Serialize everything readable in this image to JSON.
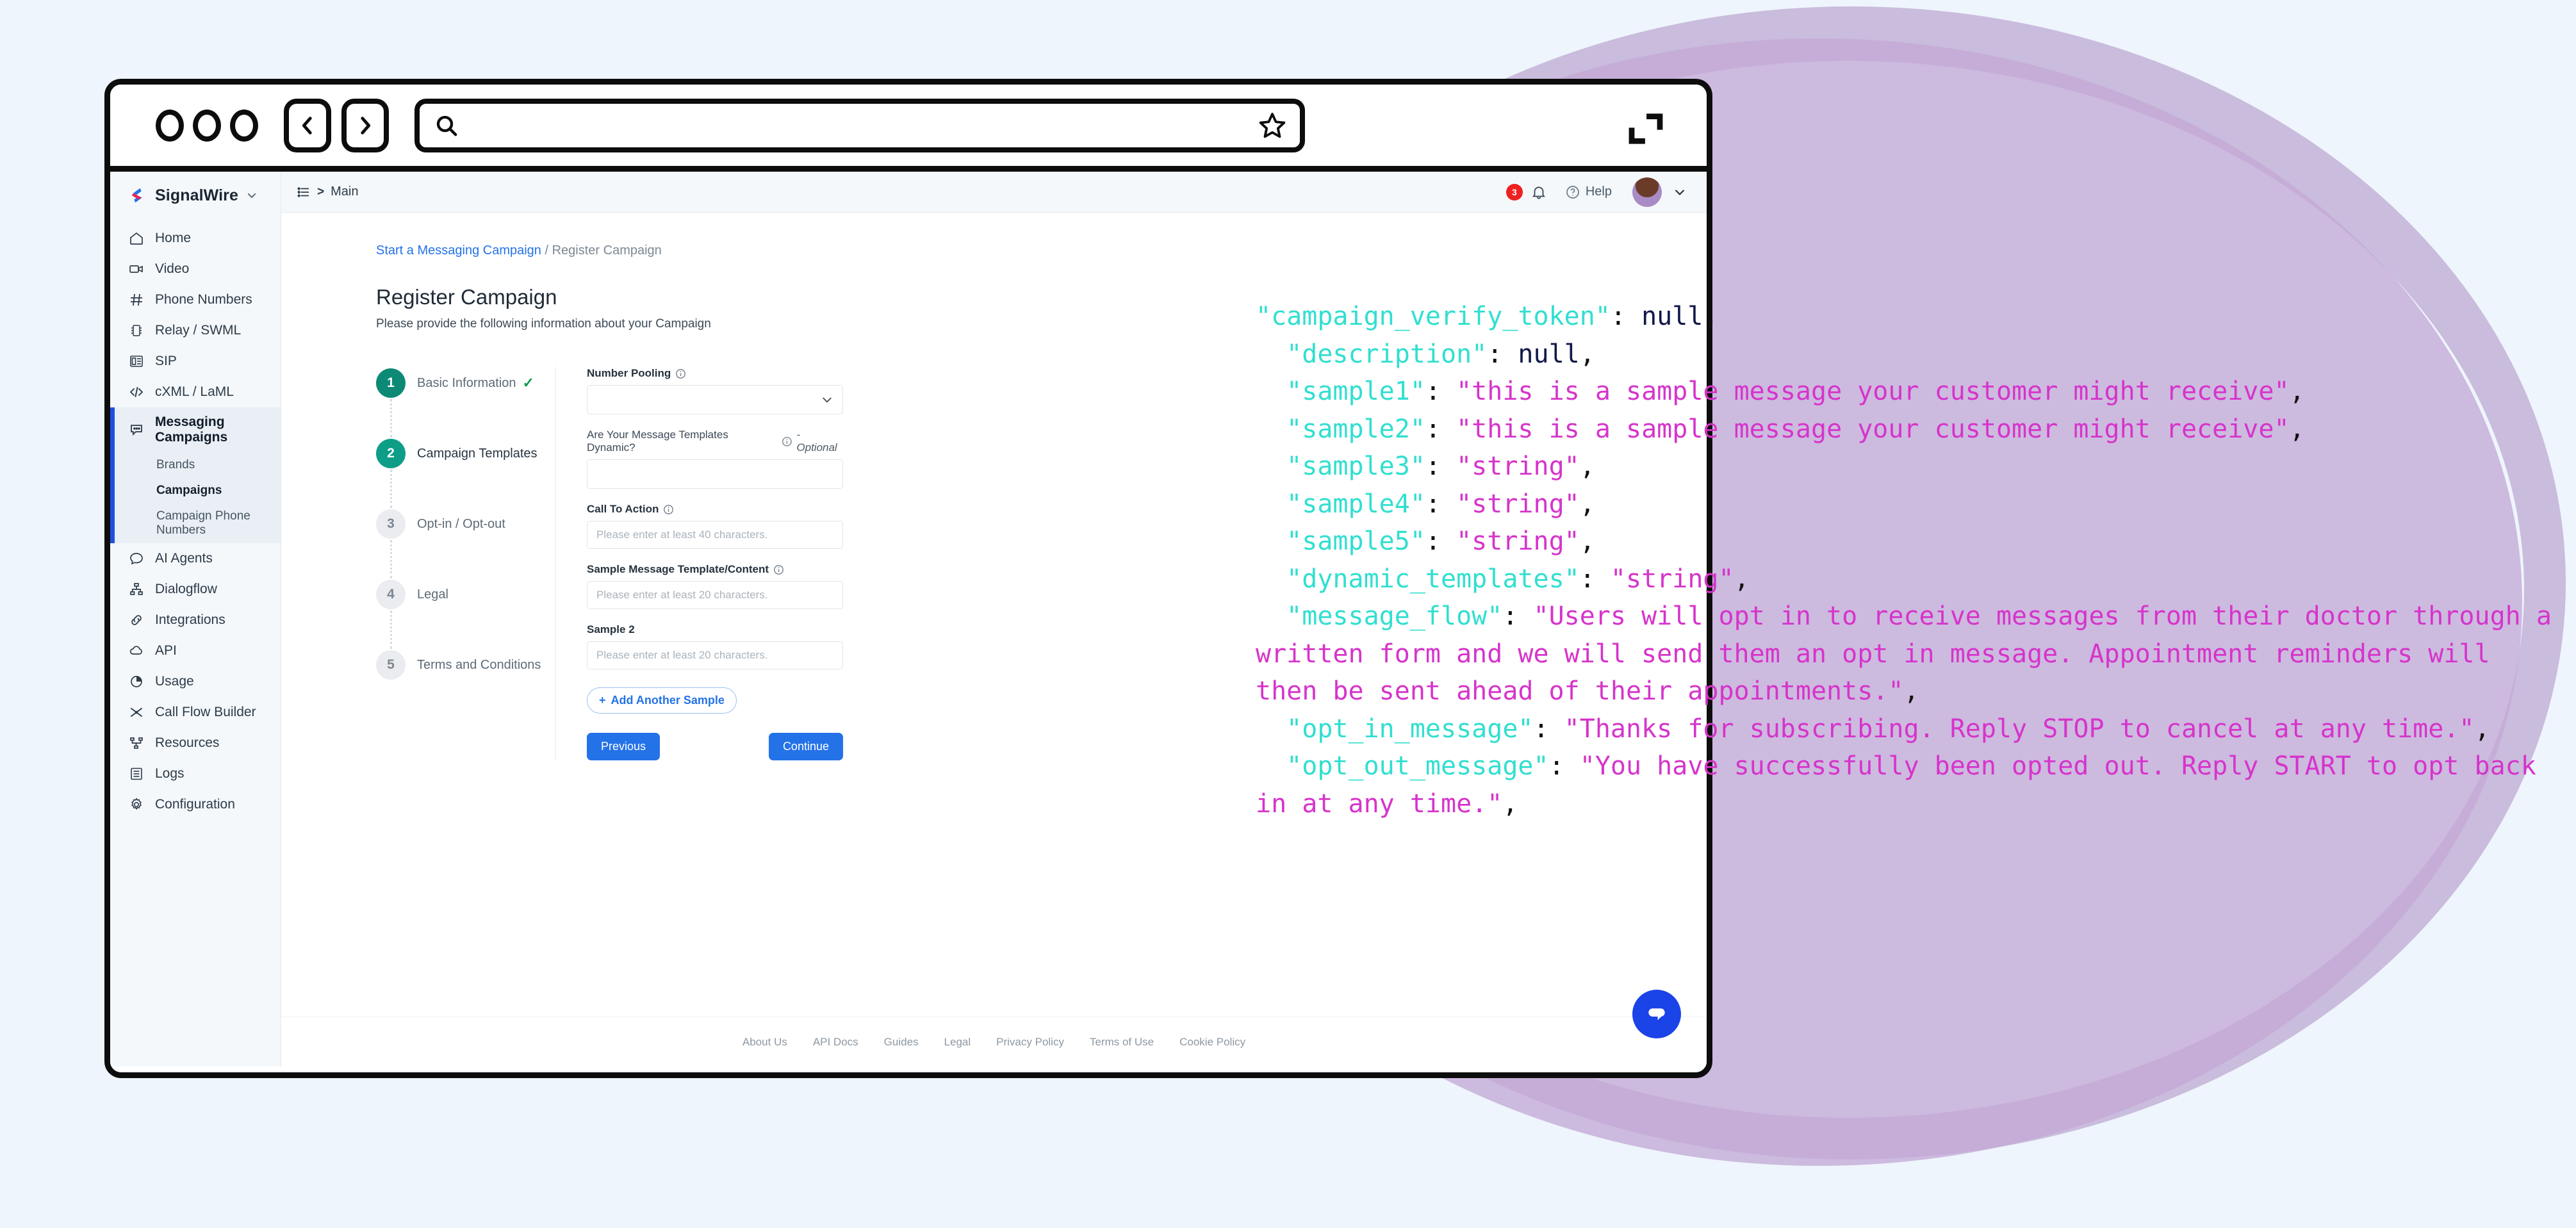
{
  "browser": {
    "dots_count": 3,
    "back_label": "back",
    "forward_label": "forward",
    "address_value": "",
    "address_placeholder": "",
    "bookmark_label": "Bookmark",
    "expand_label": "Expand"
  },
  "sidebar": {
    "brand": "SignalWire",
    "items": [
      {
        "label": "Home",
        "icon": "home-icon"
      },
      {
        "label": "Video",
        "icon": "video-icon"
      },
      {
        "label": "Phone Numbers",
        "icon": "hash-icon"
      },
      {
        "label": "Relay / SWML",
        "icon": "chip-icon"
      },
      {
        "label": "SIP",
        "icon": "deskphone-icon"
      },
      {
        "label": "cXML / LaML",
        "icon": "code-icon"
      }
    ],
    "group": {
      "label": "Messaging Campaigns",
      "icon": "chat-bubble-icon",
      "children": [
        {
          "label": "Brands"
        },
        {
          "label": "Campaigns"
        },
        {
          "label": "Campaign Phone Numbers"
        }
      ]
    },
    "items_after": [
      {
        "label": "AI Agents",
        "icon": "ai-chat-icon"
      },
      {
        "label": "Dialogflow",
        "icon": "sitemap-icon"
      },
      {
        "label": "Integrations",
        "icon": "link-icon"
      },
      {
        "label": "API",
        "icon": "cloud-icon"
      },
      {
        "label": "Usage",
        "icon": "pie-chart-icon"
      },
      {
        "label": "Call Flow Builder",
        "icon": "shuffle-icon"
      },
      {
        "label": "Resources",
        "icon": "tree-icon"
      },
      {
        "label": "Logs",
        "icon": "document-icon"
      },
      {
        "label": "Configuration",
        "icon": "gear-icon"
      }
    ]
  },
  "topbar": {
    "breadcrumb_icon": "list-icon",
    "breadcrumb_separator": ">",
    "breadcrumb_label": "Main",
    "notification_count": "3",
    "bell_icon": "bell-icon",
    "help_label": "Help",
    "help_icon": "question-circle-icon",
    "avatar_icon": "avatar",
    "avatar_chevron": "chevron-down-icon"
  },
  "content": {
    "breadcrumb_link": "Start a Messaging Campaign",
    "breadcrumb_sep": "/",
    "breadcrumb_current": "Register Campaign",
    "title": "Register Campaign",
    "subtitle": "Please provide the following information about your Campaign"
  },
  "steps": [
    {
      "number": "1",
      "label": "Basic Information",
      "state": "done",
      "check": "✓"
    },
    {
      "number": "2",
      "label": "Campaign Templates",
      "state": "current",
      "check": ""
    },
    {
      "number": "3",
      "label": "Opt-in / Opt-out",
      "state": "pending",
      "check": ""
    },
    {
      "number": "4",
      "label": "Legal",
      "state": "pending",
      "check": ""
    },
    {
      "number": "5",
      "label": "Terms and Conditions",
      "state": "pending",
      "check": ""
    }
  ],
  "form": {
    "number_pooling": {
      "label": "Number Pooling",
      "value": "",
      "info": "info-icon"
    },
    "dynamic_templates": {
      "label": "Are Your Message Templates Dynamic?",
      "optional": "- Optional",
      "value": "",
      "placeholder": ""
    },
    "call_to_action": {
      "label": "Call To Action",
      "placeholder": "Please enter at least 40 characters.",
      "value": ""
    },
    "sample_1": {
      "label": "Sample Message Template/Content",
      "placeholder": "Please enter at least 20 characters.",
      "value": ""
    },
    "sample_2": {
      "label": "Sample 2",
      "placeholder": "Please enter at least 20 characters.",
      "value": ""
    },
    "add_sample_label": "Add Another Sample",
    "add_sample_plus": "+",
    "previous_label": "Previous",
    "continue_label": "Continue"
  },
  "footer": {
    "links": [
      "About Us",
      "API Docs",
      "Guides",
      "Legal",
      "Privacy Policy",
      "Terms of Use",
      "Cookie Policy"
    ]
  },
  "chat": {
    "icon": "chat-bubble-icon"
  },
  "code_overlay": {
    "lines": [
      [
        {
          "t": "k",
          "v": "\"campaign_verify_token\""
        },
        {
          "t": "p",
          "v": ": "
        },
        {
          "t": "n",
          "v": "null"
        },
        {
          "t": "p",
          "v": ","
        }
      ],
      [
        {
          "t": "p",
          "v": "  "
        },
        {
          "t": "k",
          "v": "\"description\""
        },
        {
          "t": "p",
          "v": ": "
        },
        {
          "t": "n",
          "v": "null"
        },
        {
          "t": "p",
          "v": ","
        }
      ],
      [
        {
          "t": "p",
          "v": "  "
        },
        {
          "t": "k",
          "v": "\"sample1\""
        },
        {
          "t": "p",
          "v": ": "
        },
        {
          "t": "s",
          "v": "\"this is a sample message your customer might receive\""
        },
        {
          "t": "p",
          "v": ","
        }
      ],
      [
        {
          "t": "p",
          "v": "  "
        },
        {
          "t": "k",
          "v": "\"sample2\""
        },
        {
          "t": "p",
          "v": ": "
        },
        {
          "t": "s",
          "v": "\"this is a sample message your customer might receive\""
        },
        {
          "t": "p",
          "v": ","
        }
      ],
      [
        {
          "t": "p",
          "v": "  "
        },
        {
          "t": "k",
          "v": "\"sample3\""
        },
        {
          "t": "p",
          "v": ": "
        },
        {
          "t": "s",
          "v": "\"string\""
        },
        {
          "t": "p",
          "v": ","
        }
      ],
      [
        {
          "t": "p",
          "v": "  "
        },
        {
          "t": "k",
          "v": "\"sample4\""
        },
        {
          "t": "p",
          "v": ": "
        },
        {
          "t": "s",
          "v": "\"string\""
        },
        {
          "t": "p",
          "v": ","
        }
      ],
      [
        {
          "t": "p",
          "v": "  "
        },
        {
          "t": "k",
          "v": "\"sample5\""
        },
        {
          "t": "p",
          "v": ": "
        },
        {
          "t": "s",
          "v": "\"string\""
        },
        {
          "t": "p",
          "v": ","
        }
      ],
      [
        {
          "t": "p",
          "v": "  "
        },
        {
          "t": "k",
          "v": "\"dynamic_templates\""
        },
        {
          "t": "p",
          "v": ": "
        },
        {
          "t": "s",
          "v": "\"string\""
        },
        {
          "t": "p",
          "v": ","
        }
      ],
      [
        {
          "t": "p",
          "v": "  "
        },
        {
          "t": "k",
          "v": "\"message_flow\""
        },
        {
          "t": "p",
          "v": ": "
        },
        {
          "t": "s",
          "v": "\"Users will opt in to receive messages from their doctor through a written form and we will send them an opt in message. Appointment reminders will then be sent ahead of their appointments.\""
        },
        {
          "t": "p",
          "v": ","
        }
      ],
      [
        {
          "t": "p",
          "v": "  "
        },
        {
          "t": "k",
          "v": "\"opt_in_message\""
        },
        {
          "t": "p",
          "v": ": "
        },
        {
          "t": "s",
          "v": "\"Thanks for subscribing. Reply STOP to cancel at any time.\""
        },
        {
          "t": "p",
          "v": ","
        }
      ],
      [
        {
          "t": "p",
          "v": "  "
        },
        {
          "t": "k",
          "v": "\"opt_out_message\""
        },
        {
          "t": "p",
          "v": ": "
        },
        {
          "t": "s",
          "v": "\"You have successfully been opted out. Reply START to opt back in at any time.\""
        },
        {
          "t": "p",
          "v": ","
        }
      ]
    ]
  },
  "colors": {
    "background": "#eef5fc",
    "blob": "#c4a9d6",
    "accent_blue": "#2472e8",
    "step_teal": "#0e9e88",
    "badge_red": "#ee2020",
    "json_key": "#31dfd0",
    "json_string": "#d634cb",
    "json_null": "#121848"
  }
}
